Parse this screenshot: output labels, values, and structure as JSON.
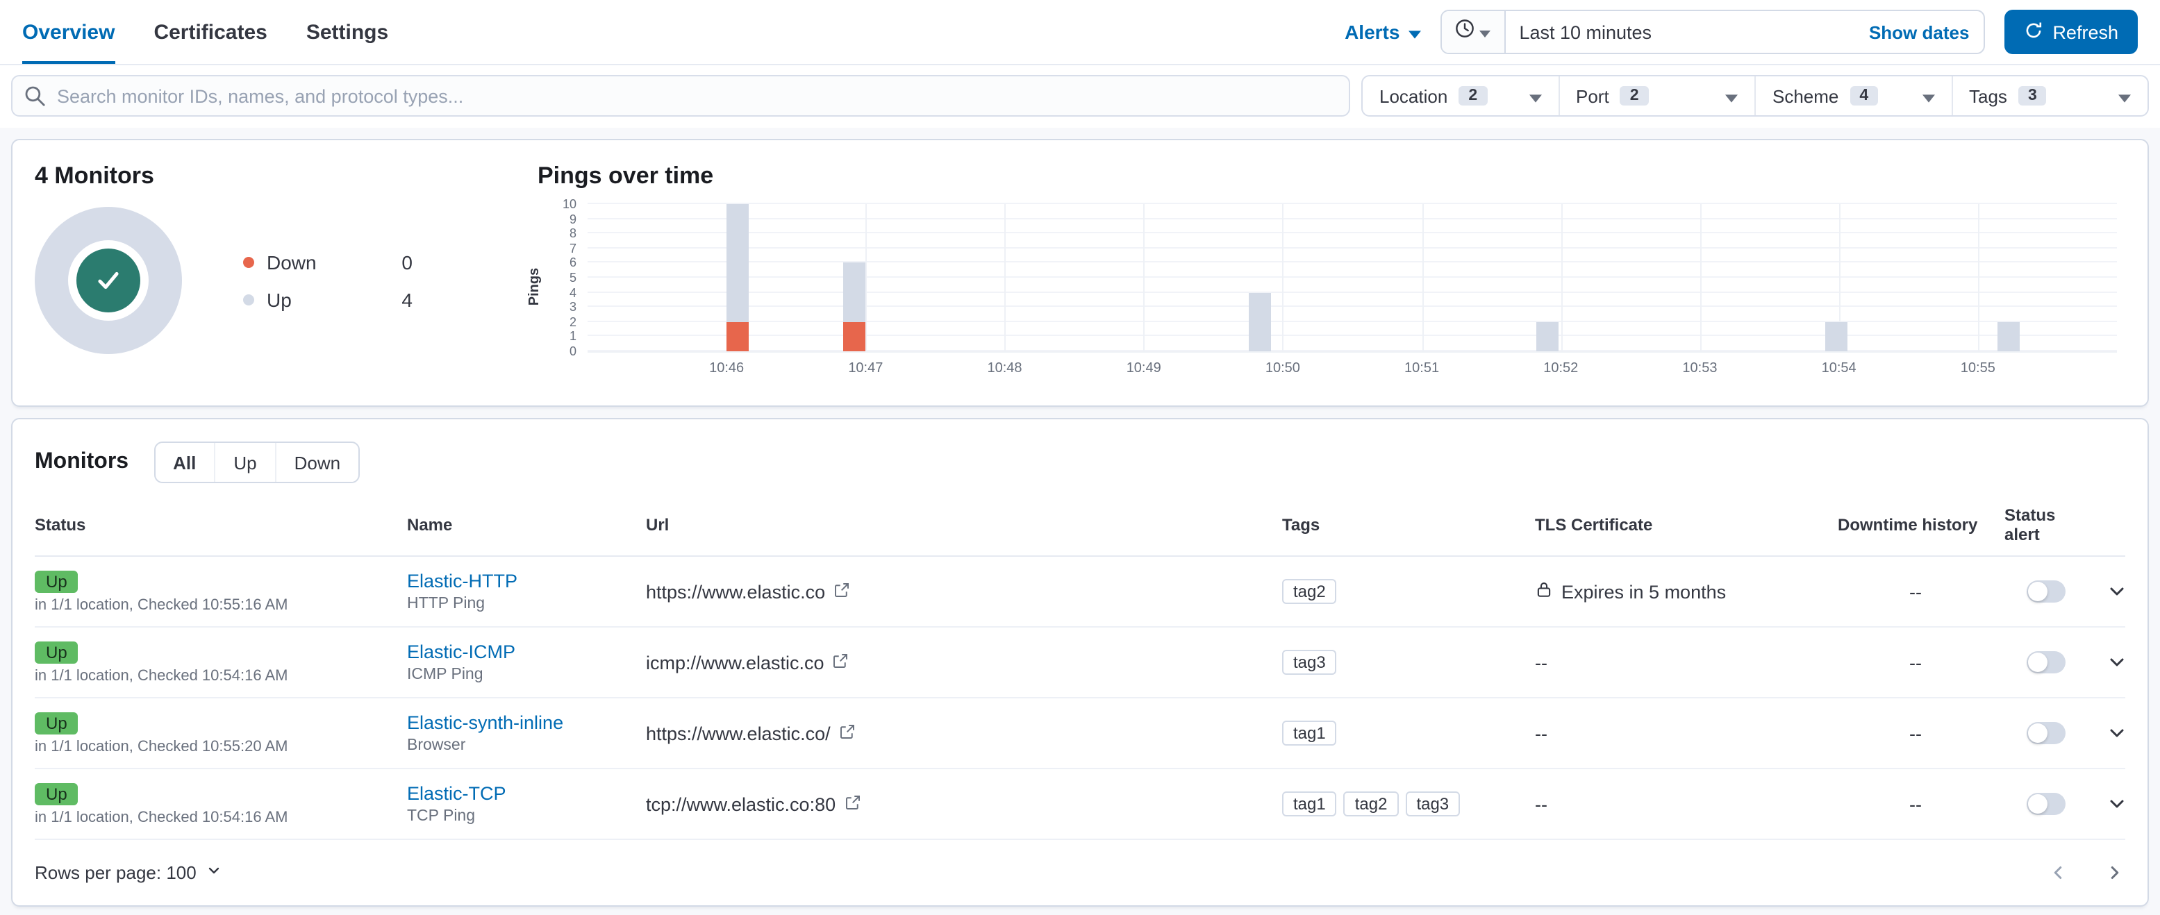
{
  "nav": {
    "tabs": [
      {
        "label": "Overview"
      },
      {
        "label": "Certificates"
      },
      {
        "label": "Settings"
      }
    ],
    "alerts_label": "Alerts",
    "time_value": "Last 10 minutes",
    "show_dates_label": "Show dates",
    "refresh_label": "Refresh"
  },
  "search": {
    "placeholder": "Search monitor IDs, names, and protocol types..."
  },
  "filters": [
    {
      "label": "Location",
      "count": "2"
    },
    {
      "label": "Port",
      "count": "2"
    },
    {
      "label": "Scheme",
      "count": "4"
    },
    {
      "label": "Tags",
      "count": "3"
    }
  ],
  "snapshot": {
    "title": "4 Monitors",
    "legend": [
      {
        "label": "Down",
        "value": "0",
        "color": "#e7664c"
      },
      {
        "label": "Up",
        "value": "4",
        "color": "#d3dae6"
      }
    ]
  },
  "chart_data": {
    "type": "bar",
    "title": "Pings over time",
    "ylabel": "Pings",
    "ylim": [
      0,
      10
    ],
    "y_ticks": [
      0,
      1,
      2,
      3,
      4,
      5,
      6,
      7,
      8,
      9,
      10
    ],
    "x_axis": {
      "start": "10:45",
      "end": "10:56",
      "span_minutes": 11,
      "tick_interval_minutes": 1
    },
    "x_ticks": [
      "10:46",
      "10:47",
      "10:48",
      "10:49",
      "10:50",
      "10:51",
      "10:52",
      "10:53",
      "10:54",
      "10:55"
    ],
    "legend_position": "none",
    "grid": true,
    "series": [
      {
        "name": "Up",
        "color": "#d3dae6"
      },
      {
        "name": "Down",
        "color": "#e7664c"
      }
    ],
    "buckets": [
      {
        "time": "10:46:05",
        "minutes_from_start": 1.08,
        "up": 8,
        "down": 2
      },
      {
        "time": "10:46:55",
        "minutes_from_start": 1.92,
        "up": 4,
        "down": 2
      },
      {
        "time": "10:49:50",
        "minutes_from_start": 4.84,
        "up": 4,
        "down": 0
      },
      {
        "time": "10:51:55",
        "minutes_from_start": 6.9,
        "up": 2,
        "down": 0
      },
      {
        "time": "10:53:58",
        "minutes_from_start": 8.98,
        "up": 2,
        "down": 0
      },
      {
        "time": "10:55:12",
        "minutes_from_start": 10.22,
        "up": 2,
        "down": 0
      }
    ]
  },
  "monitors": {
    "title": "Monitors",
    "filter_buttons": [
      {
        "label": "All",
        "selected": true
      },
      {
        "label": "Up",
        "selected": false
      },
      {
        "label": "Down",
        "selected": false
      }
    ],
    "columns": {
      "status": "Status",
      "name": "Name",
      "url": "Url",
      "tags": "Tags",
      "tls": "TLS Certificate",
      "downtime": "Downtime history",
      "alert": "Status alert"
    },
    "rows": [
      {
        "status": "Up",
        "status_detail": "in 1/1 location, Checked 10:55:16 AM",
        "name": "Elastic-HTTP",
        "monitor_type": "HTTP Ping",
        "url": "https://www.elastic.co",
        "tags": [
          "tag2"
        ],
        "tls": "Expires in 5 months",
        "downtime": "--"
      },
      {
        "status": "Up",
        "status_detail": "in 1/1 location, Checked 10:54:16 AM",
        "name": "Elastic-ICMP",
        "monitor_type": "ICMP Ping",
        "url": "icmp://www.elastic.co",
        "tags": [
          "tag3"
        ],
        "tls": "--",
        "downtime": "--"
      },
      {
        "status": "Up",
        "status_detail": "in 1/1 location, Checked 10:55:20 AM",
        "name": "Elastic-synth-inline",
        "monitor_type": "Browser",
        "url": "https://www.elastic.co/",
        "tags": [
          "tag1"
        ],
        "tls": "--",
        "downtime": "--"
      },
      {
        "status": "Up",
        "status_detail": "in 1/1 location, Checked 10:54:16 AM",
        "name": "Elastic-TCP",
        "monitor_type": "TCP Ping",
        "url": "tcp://www.elastic.co:80",
        "tags": [
          "tag1",
          "tag2",
          "tag3"
        ],
        "tls": "--",
        "downtime": "--"
      }
    ],
    "rows_per_page_label": "Rows per page: 100"
  },
  "colors": {
    "primary": "#006bb4",
    "up_badge": "#5fbb63",
    "up_bar": "#d3dae6",
    "down": "#e7664c",
    "donut_ring": "#d6dce8",
    "donut_center": "#2b7c6f"
  }
}
